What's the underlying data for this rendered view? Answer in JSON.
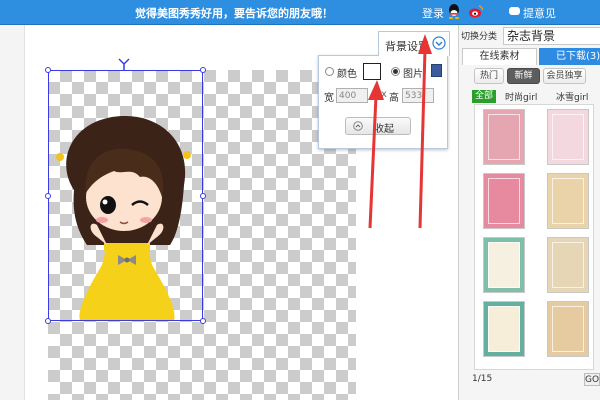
{
  "topbar": {
    "message": "觉得美图秀秀好用，要告诉您的朋友哦！",
    "login": "登录",
    "feedback": "提意见",
    "icons": [
      "qq-icon",
      "weibo-icon",
      "feedback-icon"
    ]
  },
  "bg_settings": {
    "tab_label": "背景设置",
    "color_label": "颜色",
    "image_label": "图片",
    "selected_mode": "image",
    "width_label": "宽",
    "height_label": "高",
    "width_value": "400",
    "height_value": "533",
    "x_symbol": "x",
    "collapse_label": "收起"
  },
  "right_panel": {
    "switch_label": "切换分类",
    "category_title": "杂志背景",
    "tabs": [
      {
        "label": "在线素材",
        "active": true
      },
      {
        "label": "已下载(3)",
        "active": false
      }
    ],
    "filters": [
      {
        "label": "热门",
        "active": false
      },
      {
        "label": "新鲜",
        "active": true
      },
      {
        "label": "会员独享",
        "active": false
      }
    ],
    "subfilters": [
      {
        "label": "全部",
        "active": true
      },
      {
        "label": "时尚girl",
        "active": false
      },
      {
        "label": "冰雪girl",
        "active": false
      }
    ],
    "thumbnails": [
      {
        "name": "thumb-pink-cake",
        "color": "#e5a6b2"
      },
      {
        "name": "thumb-ice-cream",
        "color": "#f3d8df"
      },
      {
        "name": "thumb-pink-stripes",
        "color": "#e78aa0"
      },
      {
        "name": "thumb-vintage-paper",
        "color": "#ead3a8"
      },
      {
        "name": "thumb-green-flowers",
        "color": "#7fbfa9"
      },
      {
        "name": "thumb-beige-frame",
        "color": "#e7d6b5"
      },
      {
        "name": "thumb-teal-frame",
        "color": "#63b0a0"
      },
      {
        "name": "thumb-floral-border",
        "color": "#e6cba1"
      }
    ],
    "page_info": "1/15",
    "go_label": "GO"
  },
  "colors": {
    "topbar": "#2e8ee0",
    "selection": "#3a3ae6",
    "arrow": "#e63535",
    "accent_tab": "#2d8be2",
    "green": "#2aa02a"
  }
}
